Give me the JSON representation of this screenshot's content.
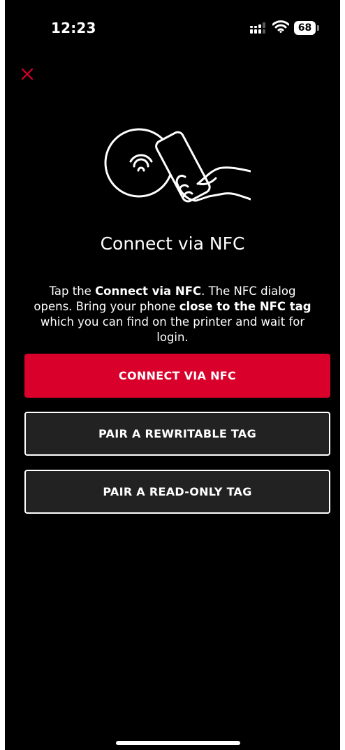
{
  "status_bar": {
    "time": "12:23",
    "battery_level": "68",
    "icons": [
      "signal-icon",
      "wifi-icon",
      "battery-icon"
    ]
  },
  "header": {
    "close_icon": "close-icon"
  },
  "illustration": {
    "icon": "nfc-phone-tap-icon"
  },
  "main": {
    "title": "Connect via NFC",
    "description": {
      "part1": "Tap the ",
      "bold1": "Connect via NFC",
      "part2": ". The NFC dialog opens. Bring your phone ",
      "bold2": "close to the NFC tag",
      "part3": " which you can find on the printer and wait for login."
    }
  },
  "buttons": {
    "connect_label": "CONNECT VIA NFC",
    "rewritable_label": "PAIR A REWRITABLE TAG",
    "readonly_label": "PAIR A READ-ONLY TAG"
  },
  "colors": {
    "accent": "#d9002b",
    "background": "#000000",
    "button_secondary_bg": "#222222",
    "text": "#ffffff"
  }
}
